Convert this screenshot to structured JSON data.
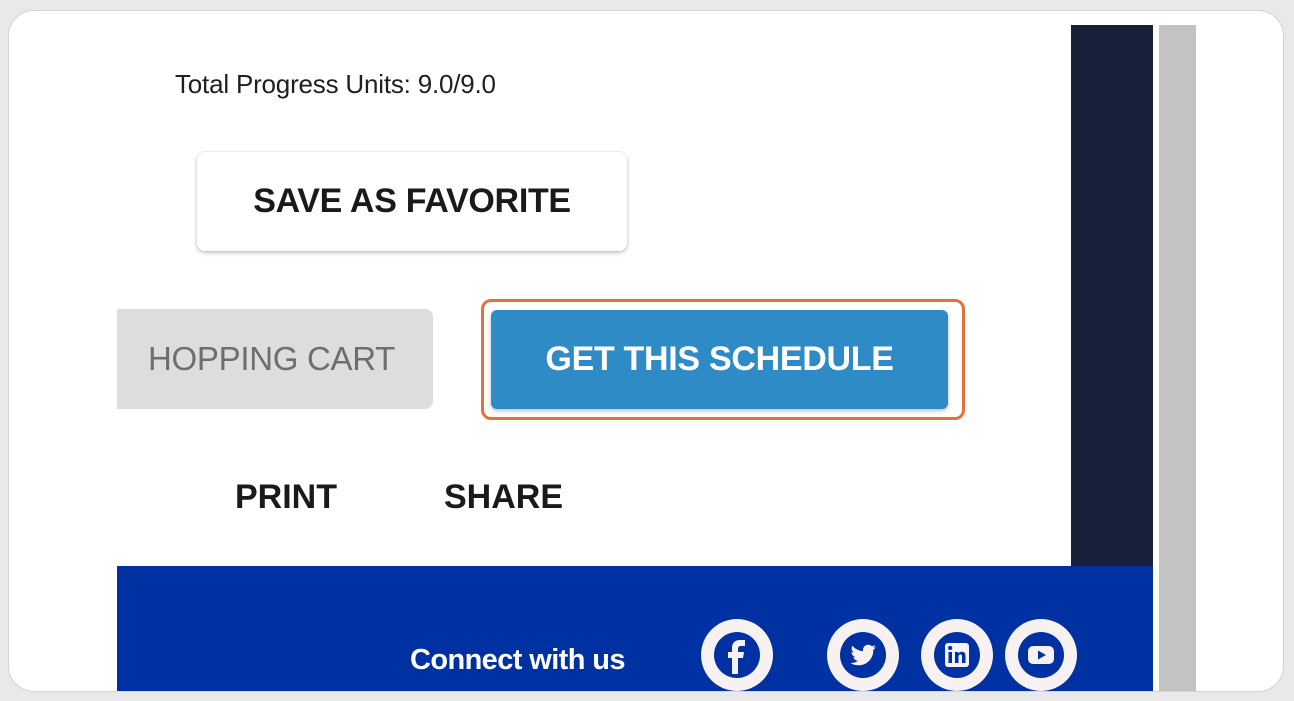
{
  "progress": {
    "text": "Total Progress Units: 9.0/9.0"
  },
  "buttons": {
    "save_favorite": "SAVE AS FAVORITE",
    "shopping_cart": "HOPPING CART",
    "get_schedule": "GET THIS SCHEDULE",
    "print": "PRINT",
    "share": "SHARE"
  },
  "footer": {
    "connect_label": "Connect with us",
    "social_icons": [
      "facebook-icon",
      "twitter-icon",
      "linkedin-icon",
      "youtube-icon"
    ]
  },
  "colors": {
    "primary_button": "#2f8bc5",
    "highlight_outline": "#e5713a",
    "footer_bg": "#0031a3",
    "dark_strip": "#17213a",
    "disabled_button": "#dddddd"
  }
}
